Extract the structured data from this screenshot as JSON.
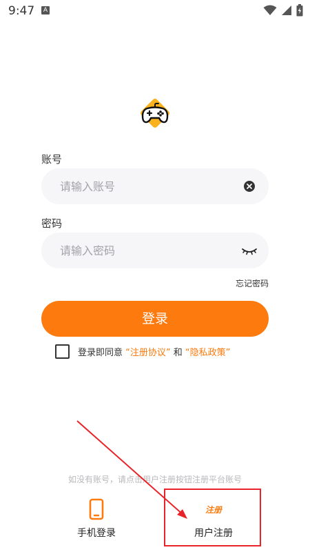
{
  "status_bar": {
    "time": "9:47",
    "notification_letter": "A"
  },
  "form": {
    "account_label": "账号",
    "account_placeholder": "请输入账号",
    "password_label": "密码",
    "password_placeholder": "请输入密码",
    "forgot_password": "忘记密码",
    "login_button": "登录"
  },
  "agreement": {
    "prefix": "登录即同意 ",
    "terms_link": "“注册协议”",
    "conjunction": " 和 ",
    "privacy_link": "“隐私政策”"
  },
  "hint": "如没有账号，请点击用户注册按钮注册平台账号",
  "bottom": {
    "phone_login_label": "手机登录",
    "register_badge": "注册",
    "register_label": "用户注册"
  },
  "colors": {
    "accent": "#fc7a0e",
    "logo_yellow": "#f9b21d",
    "annotation_red": "#e8242a"
  },
  "icons": {
    "status": [
      "wifi-icon",
      "signal-icon",
      "battery-icon"
    ],
    "logo": "gamepad-icon",
    "account_clear": "clear-icon",
    "password_toggle": "eye-closed-icon",
    "phone": "phone-icon"
  }
}
